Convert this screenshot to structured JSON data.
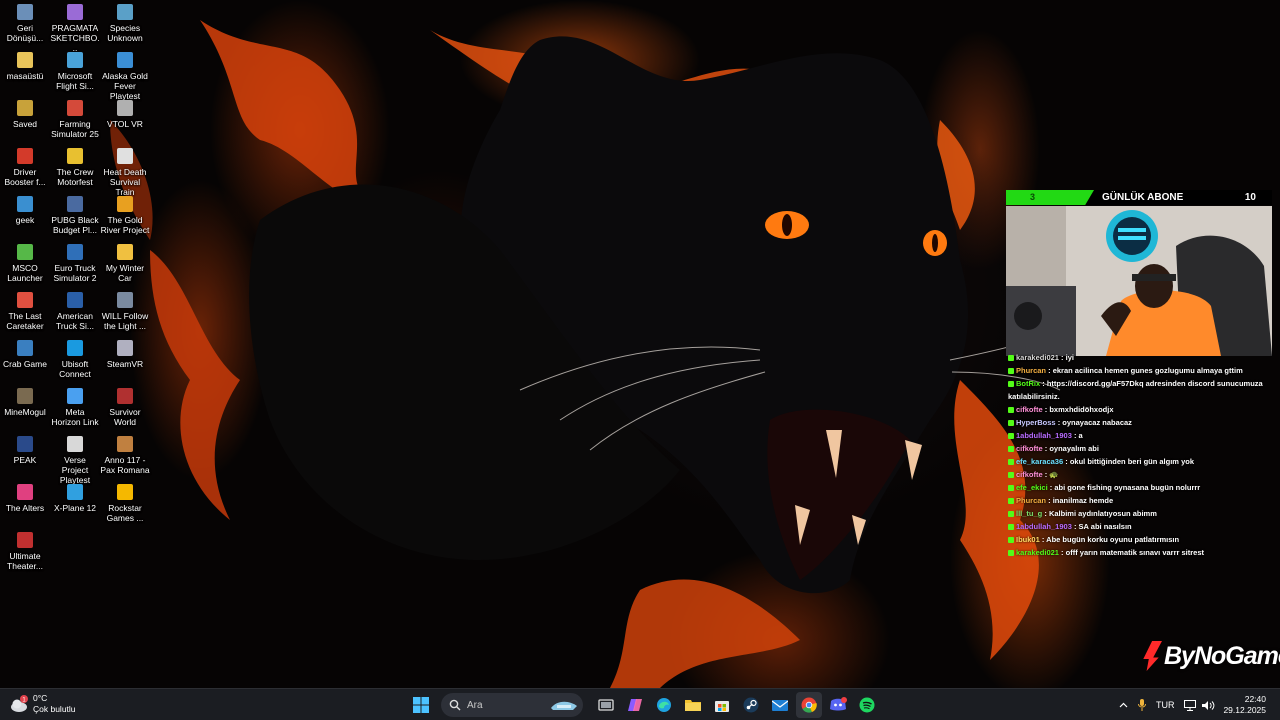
{
  "desktop": {
    "icons": [
      {
        "label": "Geri Dönüşü...",
        "icon": "recycle-bin-icon"
      },
      {
        "label": "PRAGMATA SKETCHBO...",
        "icon": "game-icon"
      },
      {
        "label": "Species Unknown",
        "icon": "game-icon"
      },
      {
        "label": "masaüstü",
        "icon": "folder-icon"
      },
      {
        "label": "Microsoft Flight Si...",
        "icon": "game-icon"
      },
      {
        "label": "Alaska Gold Fever Playtest",
        "icon": "game-icon"
      },
      {
        "label": "Saved",
        "icon": "game-icon"
      },
      {
        "label": "Farming Simulator 25",
        "icon": "game-icon"
      },
      {
        "label": "VTOL VR",
        "icon": "game-icon"
      },
      {
        "label": "Driver Booster f...",
        "icon": "app-icon"
      },
      {
        "label": "The Crew Motorfest",
        "icon": "game-icon"
      },
      {
        "label": "Heat Death Survival Train",
        "icon": "game-icon"
      },
      {
        "label": "geek",
        "icon": "app-icon"
      },
      {
        "label": "PUBG Black Budget Pl...",
        "icon": "game-icon"
      },
      {
        "label": "The Gold River Project",
        "icon": "game-icon"
      },
      {
        "label": "MSCO Launcher",
        "icon": "game-icon"
      },
      {
        "label": "Euro Truck Simulator 2",
        "icon": "game-icon"
      },
      {
        "label": "My Winter Car",
        "icon": "game-icon"
      },
      {
        "label": "The Last Caretaker",
        "icon": "game-icon"
      },
      {
        "label": "American Truck Si...",
        "icon": "game-icon"
      },
      {
        "label": "WILL Follow the Light ...",
        "icon": "game-icon"
      },
      {
        "label": "Crab Game",
        "icon": "game-icon"
      },
      {
        "label": "Ubisoft Connect",
        "icon": "app-icon"
      },
      {
        "label": "SteamVR",
        "icon": "app-icon"
      },
      {
        "label": "MineMogul",
        "icon": "game-icon"
      },
      {
        "label": "Meta Horizon Link",
        "icon": "app-icon"
      },
      {
        "label": "Survivor World",
        "icon": "game-icon"
      },
      {
        "label": "PEAK",
        "icon": "game-icon"
      },
      {
        "label": "Verse Project Playtest",
        "icon": "game-icon"
      },
      {
        "label": "Anno 117 - Pax Romana",
        "icon": "game-icon"
      },
      {
        "label": "The Alters",
        "icon": "game-icon"
      },
      {
        "label": "X-Plane 12",
        "icon": "game-icon"
      },
      {
        "label": "Rockstar Games ...",
        "icon": "app-icon"
      },
      {
        "label": "Ultimate Theater...",
        "icon": "game-icon"
      }
    ]
  },
  "overlay": {
    "left_number": "3",
    "title": "GÜNLÜK ABONE",
    "right_number": "10",
    "brand": "ByNoGame"
  },
  "chat": [
    {
      "user": "karakedi021",
      "text": ": iyi",
      "color": "#d9d9d9"
    },
    {
      "user": "Phurcan",
      "text": ": ekran acilinca hemen gunes gozlugumu almaya gttim",
      "color": "#f5b041"
    },
    {
      "user": "BotRix",
      "text": ": https://discord.gg/aF57Dkq adresinden discord sunucumuza katılabilirsiniz.",
      "color": "#53fc18"
    },
    {
      "user": "cifkofte",
      "text": ": bxmxhdidöhxodjx",
      "color": "#ff8fd6"
    },
    {
      "user": "HyperBoss",
      "text": ": oynayacaz nabacaz",
      "color": "#c8c8ff"
    },
    {
      "user": "1abdullah_1903",
      "text": ": a",
      "color": "#b86bff"
    },
    {
      "user": "cifkofte",
      "text": ": oynayalım abi",
      "color": "#ff8fd6"
    },
    {
      "user": "efe_karaca36",
      "text": ": okul bittiğinden beri gün algım yok",
      "color": "#6be0ff"
    },
    {
      "user": "cifkofte",
      "text": ": 🐢",
      "color": "#ff8fd6"
    },
    {
      "user": "efe_ekici",
      "text": ": abi gone fishing oynasana bugün nolurrr",
      "color": "#53fc18"
    },
    {
      "user": "Phurcan",
      "text": ": inanilmaz hemde",
      "color": "#f5b041"
    },
    {
      "user": "lll_tu_g",
      "text": ": Kalbimi aydınlatıyosun abimm",
      "color": "#7be06b"
    },
    {
      "user": "1abdullah_1903",
      "text": ": SA abi nasılsın",
      "color": "#b86bff"
    },
    {
      "user": "Ibuk01",
      "text": ": Abe bugün korku oyunu patlatırmısın",
      "color": "#ffd966"
    },
    {
      "user": "karakedi021",
      "text": ": offf yarın matematik sınavı varrr sitrest",
      "color": "#53fc18"
    }
  ],
  "taskbar": {
    "weather_temp": "0°C",
    "weather_desc": "Çok bulutlu",
    "weather_badge": "1",
    "search_placeholder": "Ara",
    "pinned": [
      "start-icon",
      "search-icon",
      "task-view-icon",
      "copilot-icon",
      "edge-icon",
      "file-explorer-icon",
      "store-icon",
      "steam-icon",
      "mail-icon",
      "chrome-icon",
      "discord-icon",
      "spotify-icon"
    ],
    "language": "TUR",
    "time": "22:40",
    "date": "29.12.2025"
  }
}
